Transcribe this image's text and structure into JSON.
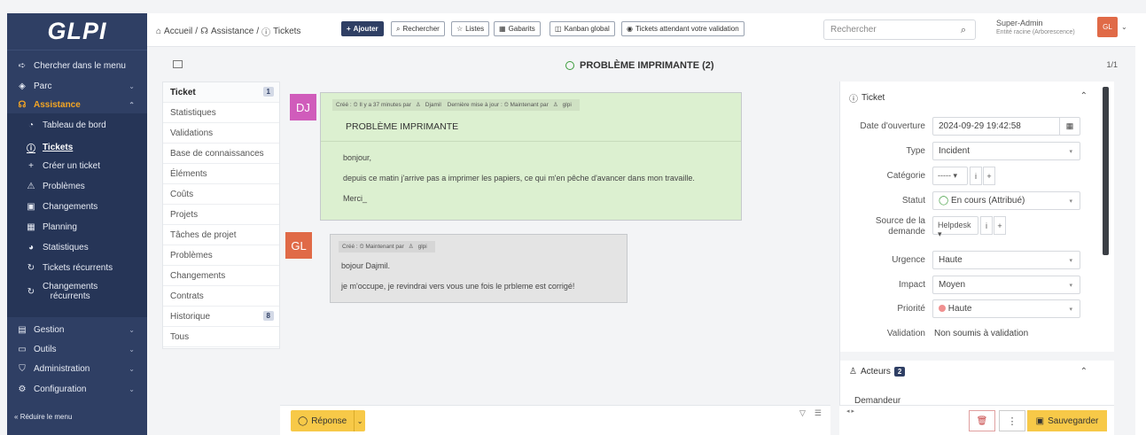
{
  "sidebar": {
    "logo": "GLPI",
    "search_menu": "Chercher dans le menu",
    "parc": "Parc",
    "assistance": "Assistance",
    "items": [
      {
        "label": "Tableau de bord",
        "icon": "dashboard-icon"
      },
      {
        "label": "Tickets",
        "icon": "ticket-icon"
      },
      {
        "label": "Créer un ticket",
        "icon": "plus-icon"
      },
      {
        "label": "Problèmes",
        "icon": "warning-icon"
      },
      {
        "label": "Changements",
        "icon": "clipboard-icon"
      },
      {
        "label": "Planning",
        "icon": "calendar-icon"
      },
      {
        "label": "Statistiques",
        "icon": "chart-icon"
      },
      {
        "label": "Tickets récurrents",
        "icon": "recurring-icon"
      },
      {
        "label": "Changements",
        "label2": "récurrents",
        "icon": "recurring-icon"
      }
    ],
    "gestion": "Gestion",
    "outils": "Outils",
    "administration": "Administration",
    "configuration": "Configuration",
    "collapse": "Réduire le menu"
  },
  "header": {
    "bc_home": "Accueil",
    "bc_assist": "Assistance",
    "bc_tickets": "Tickets",
    "btn_add": "Ajouter",
    "btn_search": "Rechercher",
    "btn_lists": "Listes",
    "btn_templates": "Gabarits",
    "btn_kanban": "Kanban global",
    "btn_pending": "Tickets attendant votre validation",
    "search_placeholder": "Rechercher",
    "user_name": "Super-Admin",
    "user_entity": "Entité racine (Arborescence)",
    "avatar": "GL"
  },
  "ticket": {
    "title": "PROBLÈME IMPRIMANTE (2)",
    "pager": "1/1"
  },
  "tabs": [
    {
      "label": "Ticket",
      "count": "1"
    },
    {
      "label": "Statistiques"
    },
    {
      "label": "Validations"
    },
    {
      "label": "Base de connaissances"
    },
    {
      "label": "Éléments"
    },
    {
      "label": "Coûts"
    },
    {
      "label": "Projets"
    },
    {
      "label": "Tâches de projet"
    },
    {
      "label": "Problèmes"
    },
    {
      "label": "Changements"
    },
    {
      "label": "Contrats"
    },
    {
      "label": "Historique",
      "count": "8"
    },
    {
      "label": "Tous"
    }
  ],
  "timeline": {
    "first": {
      "avatar": "DJ",
      "meta_created": "Créé : ⏲ Il y a 37 minutes par",
      "meta_author": "Djamil",
      "meta_updated": "Dernière mise à jour : ⏲ Maintenant par",
      "meta_updater": "glpi",
      "heading": "PROBLÈME IMPRIMANTE",
      "line1": "bonjour,",
      "line2": "depuis ce matin j'arrive pas a imprimer les papiers, ce qui m'en pêche d'avancer dans mon travaille.",
      "line3": "Merci_"
    },
    "second": {
      "avatar": "GL",
      "meta_created": "Créé : ⏲ Maintenant par",
      "meta_author": "glpi",
      "line1": "bojour Dajmil.",
      "line2": "je m'occupe, je revindrai vers vous une fois le prbleme est corrigé!"
    },
    "reply": "Réponse"
  },
  "panel": {
    "ticket_head": "Ticket",
    "date_label": "Date d'ouverture",
    "date_value": "2024-09-29 19:42:58",
    "type_label": "Type",
    "type_value": "Incident",
    "cat_label": "Catégorie",
    "cat_value": "-----",
    "status_label": "Statut",
    "status_value": "En cours (Attribué)",
    "source_label1": "Source de la",
    "source_label2": "demande",
    "source_value": "Helpdesk",
    "urgence_label": "Urgence",
    "urgence_value": "Haute",
    "impact_label": "Impact",
    "impact_value": "Moyen",
    "priority_label": "Priorité",
    "priority_value": "Haute",
    "validation_label": "Validation",
    "validation_value": "Non soumis à validation",
    "actors_head": "Acteurs",
    "actors_count": "2",
    "requester": "Demandeur",
    "save": "Sauvegarder"
  },
  "colors": {
    "sidebar": "#2f3f64",
    "accent": "#f5a623",
    "first_bubble": "#dcf0d0",
    "second_bubble": "#e4e4e4",
    "dj_avatar": "#d05cbb",
    "gl_avatar": "#e06a47",
    "save": "#f7c948"
  }
}
